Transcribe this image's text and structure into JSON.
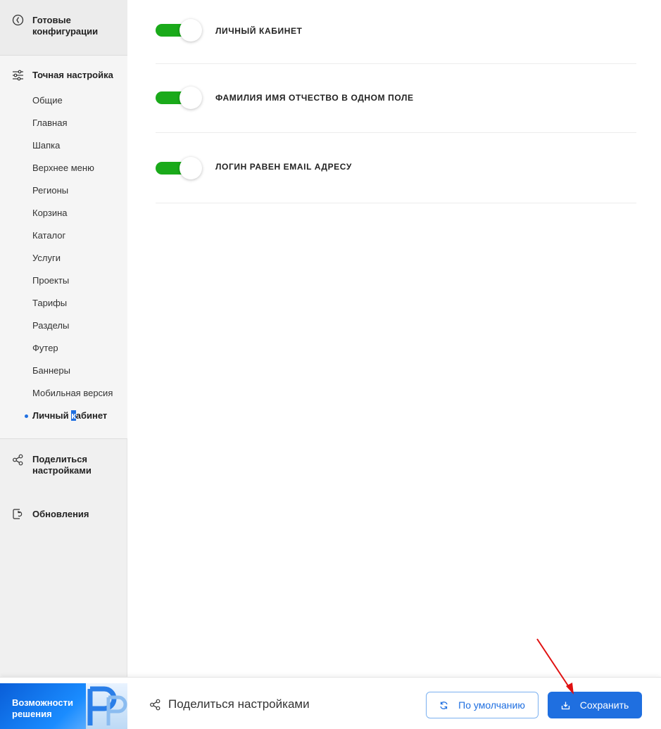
{
  "sidebar": {
    "ready_configs": "Готовые конфигурации",
    "fine_tuning": {
      "title": "Точная настройка",
      "items": [
        "Общие",
        "Главная",
        "Шапка",
        "Верхнее меню",
        "Регионы",
        "Корзина",
        "Каталог",
        "Услуги",
        "Проекты",
        "Тарифы",
        "Разделы",
        "Футер",
        "Баннеры",
        "Мобильная версия"
      ],
      "active_item": {
        "before": "Личный ",
        "cursor": "к",
        "after": "абинет"
      }
    },
    "share_settings": "Поделиться настройками",
    "updates": "Обновления"
  },
  "options": [
    {
      "label": "ЛИЧНЫЙ КАБИНЕТ",
      "enabled": true
    },
    {
      "label": "ФАМИЛИЯ ИМЯ ОТЧЕСТВО В ОДНОМ ПОЛЕ",
      "enabled": true
    },
    {
      "label": "ЛОГИН РАВЕН EMAIL АДРЕСУ",
      "enabled": true
    }
  ],
  "bottom": {
    "promo": "Возможности решения",
    "share_label": "Поделиться настройками",
    "default_label": "По умолчанию",
    "save_label": "Сохранить"
  },
  "colors": {
    "accent": "#1f6fe0",
    "toggle_on": "#1aaa1a",
    "annotation_arrow": "#e01010"
  }
}
